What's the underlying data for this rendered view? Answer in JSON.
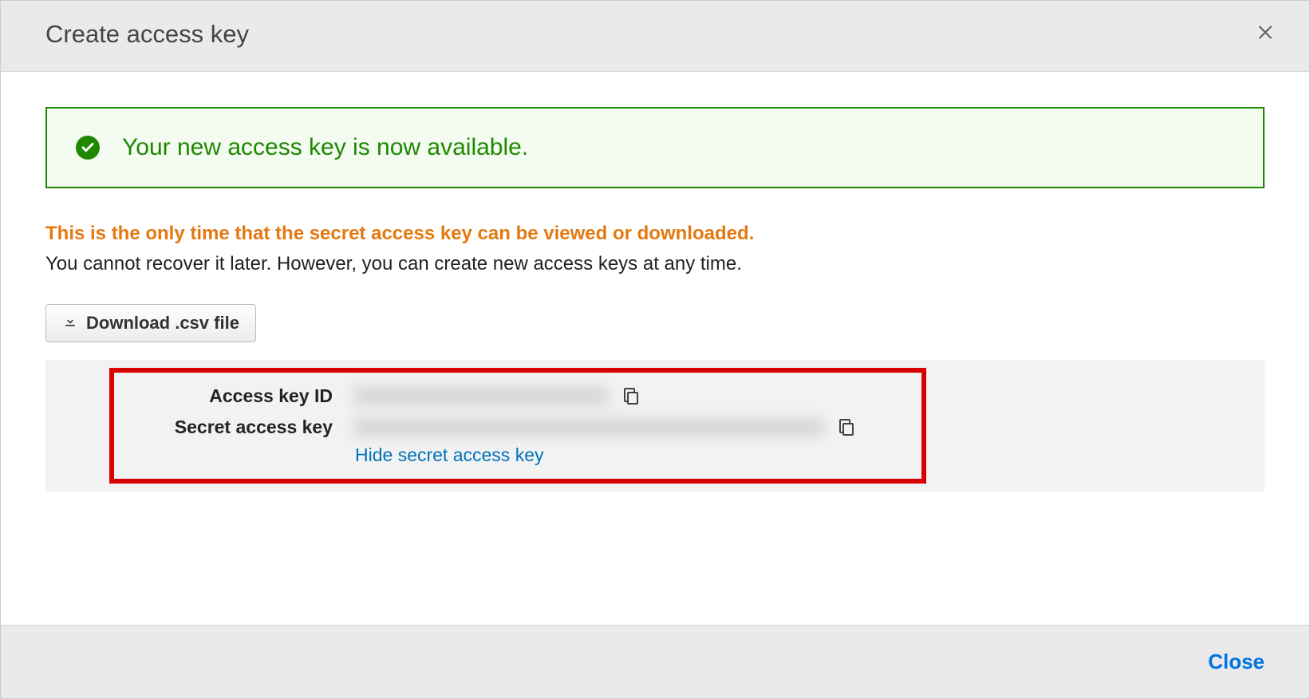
{
  "header": {
    "title": "Create access key"
  },
  "success": {
    "message": "Your new access key is now available."
  },
  "warning": {
    "line1": "This is the only time that the secret access key can be viewed or downloaded.",
    "line2": "You cannot recover it later. However, you can create new access keys at any time."
  },
  "download_button_label": "Download .csv file",
  "keys": {
    "access_key_id_label": "Access key ID",
    "secret_access_key_label": "Secret access key",
    "hide_link_label": "Hide secret access key"
  },
  "footer": {
    "close_label": "Close"
  }
}
